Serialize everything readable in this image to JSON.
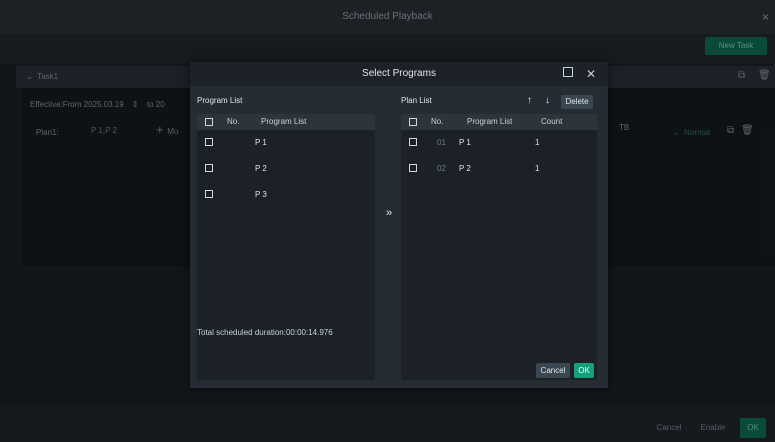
{
  "window": {
    "title": "Scheduled Playback",
    "close_icon": "×"
  },
  "toolbar": {
    "new_task": "New Task"
  },
  "task": {
    "name": "Task1",
    "effective_text": "Effective:From  2025.03.19",
    "to_text": "to  20",
    "plan_label": "Plan1:",
    "plan_value": "P 1,P 2",
    "more_text": "Mo",
    "tb_text": "TB",
    "normal_text": "Normal"
  },
  "footer": {
    "cancel": "Cancel",
    "enable": "Enable",
    "ok": "OK"
  },
  "dialog": {
    "title": "Select Programs",
    "program_list": {
      "title": "Program List",
      "headers": [
        "No.",
        "Program List"
      ],
      "rows": [
        {
          "name": "P 1"
        },
        {
          "name": "P 2"
        },
        {
          "name": "P 3"
        }
      ]
    },
    "plan_list": {
      "title": "Plan List",
      "headers": [
        "No.",
        "Program List",
        "Count"
      ],
      "rows": [
        {
          "no": "01",
          "name": "P 1",
          "count": "1"
        },
        {
          "no": "02",
          "name": "P 2",
          "count": "1"
        }
      ],
      "delete": "Delete"
    },
    "transfer_icon": "»",
    "up_icon": "↑",
    "down_icon": "↓",
    "duration": "Total scheduled duration:00:00:14.976",
    "cancel": "Cancel",
    "ok": "OK"
  },
  "colors": {
    "accent": "#14a07a",
    "background": "#1b2127",
    "panel": "#252c33"
  }
}
